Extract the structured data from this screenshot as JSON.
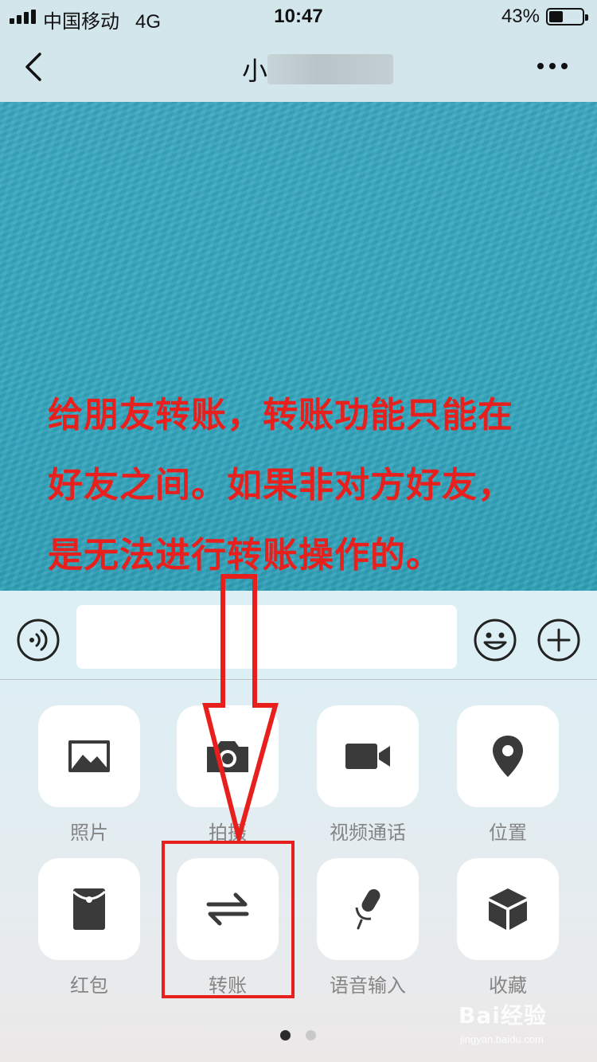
{
  "status_bar": {
    "carrier": "中国移动",
    "network": "4G",
    "time": "10:47",
    "battery_percent": "43%",
    "battery_level": 0.43
  },
  "nav": {
    "title_visible": "小",
    "more_icon": "more-dots-icon",
    "back_icon": "chevron-left-icon"
  },
  "annotation": {
    "lines": [
      "给朋友转账，转账功能只能在",
      "好友之间。如果非对方好友，",
      "是无法进行转账操作的。"
    ],
    "color": "#e8201d"
  },
  "input_bar": {
    "text_value": "",
    "icons": [
      "voice-icon",
      "emoji-icon",
      "plus-icon"
    ]
  },
  "panel": {
    "items": [
      {
        "label": "照片",
        "icon": "photo-icon"
      },
      {
        "label": "拍摄",
        "icon": "camera-icon"
      },
      {
        "label": "视频通话",
        "icon": "video-call-icon"
      },
      {
        "label": "位置",
        "icon": "location-icon"
      },
      {
        "label": "红包",
        "icon": "red-packet-icon"
      },
      {
        "label": "转账",
        "icon": "transfer-icon"
      },
      {
        "label": "语音输入",
        "icon": "microphone-icon"
      },
      {
        "label": "收藏",
        "icon": "favorites-cube-icon"
      }
    ],
    "page_count": 2,
    "current_page": 1
  },
  "watermark": {
    "logo": "Bai经验",
    "url": "jingyan.baidu.com"
  },
  "colors": {
    "chat_background": "#33a6be",
    "icon_dark": "#3a3a3a",
    "label_gray": "#858585",
    "highlight_red": "#e8201d"
  }
}
